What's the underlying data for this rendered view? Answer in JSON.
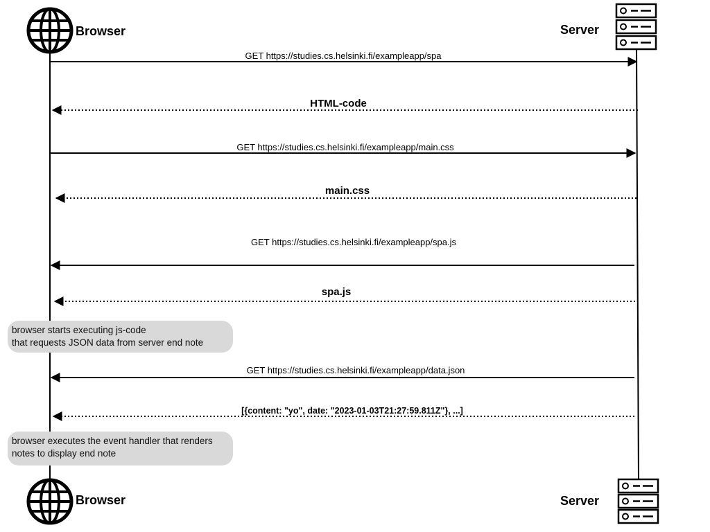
{
  "actors": {
    "browser": {
      "name": "Browser",
      "icon": "globe-icon"
    },
    "server": {
      "name": "Server",
      "icon": "server-icon"
    }
  },
  "messages": [
    {
      "text": "GET https://studies.cs.helsinki.fi/exampleapp/spa",
      "kind": "request",
      "line": "solid",
      "from": "browser",
      "to": "server"
    },
    {
      "text": "HTML-code",
      "kind": "response",
      "line": "dotted",
      "from": "server",
      "to": "browser"
    },
    {
      "text": "GET https://studies.cs.helsinki.fi/exampleapp/main.css",
      "kind": "request",
      "line": "solid",
      "from": "browser",
      "to": "server"
    },
    {
      "text": "main.css",
      "kind": "response",
      "line": "dotted",
      "from": "server",
      "to": "browser"
    },
    {
      "text": "GET https://studies.cs.helsinki.fi/exampleapp/spa.js",
      "kind": "request",
      "line": "solid",
      "from": "server",
      "to": "browser"
    },
    {
      "text": "spa.js",
      "kind": "response",
      "line": "dotted",
      "from": "server",
      "to": "browser"
    },
    {
      "text": "GET https://studies.cs.helsinki.fi/exampleapp/data.json",
      "kind": "request",
      "line": "solid",
      "from": "server",
      "to": "browser"
    },
    {
      "text": "[{content: \"yo\", date: \"2023-01-03T21:27:59.811Z\"}, ...]",
      "kind": "response",
      "line": "dotted",
      "from": "server",
      "to": "browser"
    }
  ],
  "notes": [
    {
      "text": "browser starts executing js-code\nthat requests JSON data from server end note"
    },
    {
      "text": "browser executes the event handler that renders\nnotes to display end note"
    }
  ],
  "colors": {
    "line": "#000000",
    "note_bg": "#d9d9d9"
  }
}
